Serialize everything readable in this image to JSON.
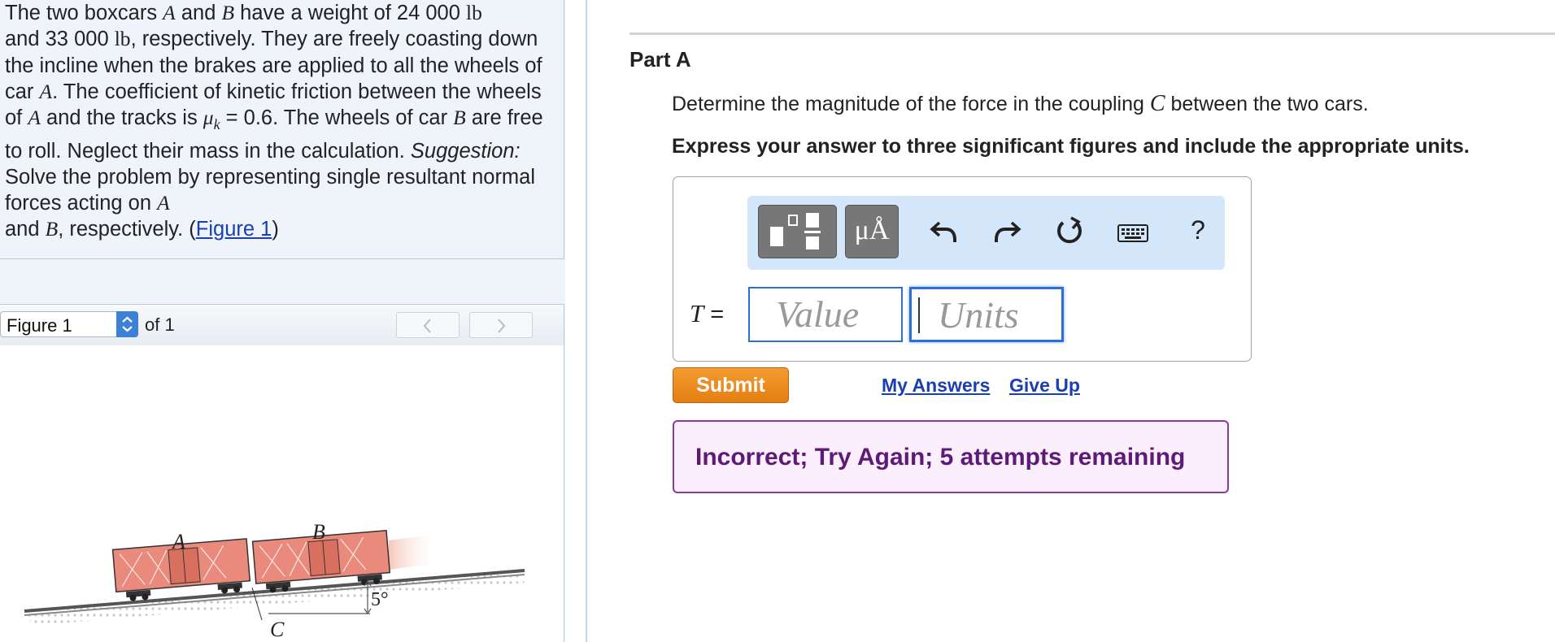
{
  "problem": {
    "seg1": "The two boxcars ",
    "var_a": "A",
    "seg2": " and ",
    "var_b": "B",
    "seg3": " have a weight of 24 000 ",
    "unit_lb": "lb",
    "seg4": "and 33 000 ",
    "unit_lb2": "lb",
    "seg5": ", respectively. They are freely coasting down the incline when the brakes are applied to all the wheels of car ",
    "var_a2": "A",
    "seg6": ". The coefficient of kinetic friction between the wheels of ",
    "var_a3": "A",
    "seg7": " and the tracks is ",
    "mu": "μ",
    "mu_sub": "k",
    "seg8": " = 0.6. The wheels of car ",
    "var_b2": "B",
    "seg9": " are free to roll. Neglect their mass in the calculation. ",
    "suggestion_label": "Suggestion:",
    "seg10": " Solve the problem by representing single resultant normal forces acting on ",
    "var_a4": "A",
    "seg11": "and ",
    "var_b3": "B",
    "seg12": ", respectively. (",
    "figure_link": "Figure 1",
    "seg13": ")"
  },
  "figure_nav": {
    "selected": "Figure 1",
    "of_label": "of 1",
    "prev_icon": "chevron-left-icon",
    "next_icon": "chevron-right-icon"
  },
  "figure": {
    "label_a": "A",
    "label_b": "B",
    "label_c": "C",
    "angle": "5°"
  },
  "part": {
    "title": "Part A",
    "question_pre": "Determine the magnitude of the force in the coupling ",
    "question_var": "C",
    "question_post": " between the two cars.",
    "instruction": "Express your answer to three significant figures and include the appropriate units."
  },
  "toolbar": {
    "templates_icon": "templates-icon",
    "units_label": "μÅ",
    "undo_icon": "undo-icon",
    "redo_icon": "redo-icon",
    "reset_icon": "reset-icon",
    "keyboard_icon": "keyboard-icon",
    "help_label": "?"
  },
  "answer": {
    "variable": "T",
    "equals": " =",
    "value_placeholder": "Value",
    "units_placeholder": "Units"
  },
  "actions": {
    "submit": "Submit",
    "my_answers": "My Answers",
    "give_up": "Give Up"
  },
  "feedback": {
    "message": "Incorrect; Try Again; 5 attempts remaining"
  },
  "colors": {
    "submit": "#e8851a",
    "link": "#1a3fb0",
    "feedback_border": "#8a3a9a",
    "feedback_text": "#5e1a77",
    "input_border": "#2d6fd6",
    "toolbar_bg": "#d3e6fa"
  }
}
